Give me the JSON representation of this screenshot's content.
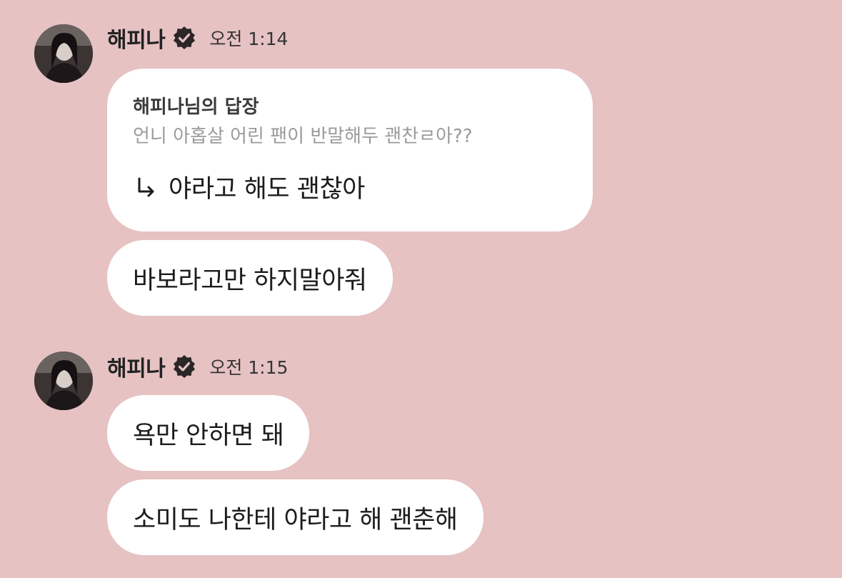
{
  "groups": [
    {
      "sender": "해피나",
      "time": "오전 1:14",
      "reply": {
        "title": "해피나님의 답장",
        "quote": "언니 아홉살 어린 팬이 반말해두 괜찬ㄹ아??",
        "answer": "야라고 해도 괜찮아"
      },
      "messages": [
        "바보라고만 하지말아줘"
      ]
    },
    {
      "sender": "해피나",
      "time": "오전 1:15",
      "messages": [
        "욕만 안하면 돼",
        "소미도 나한테 야라고 해 괜춘해"
      ]
    }
  ],
  "icons": {
    "verified": "verified-badge-icon",
    "reply_arrow": "reply-arrow-icon"
  },
  "colors": {
    "background": "#e6c2c3",
    "bubble": "#ffffff",
    "quote_text": "#9a9a9a",
    "text": "#1c1c1c"
  }
}
